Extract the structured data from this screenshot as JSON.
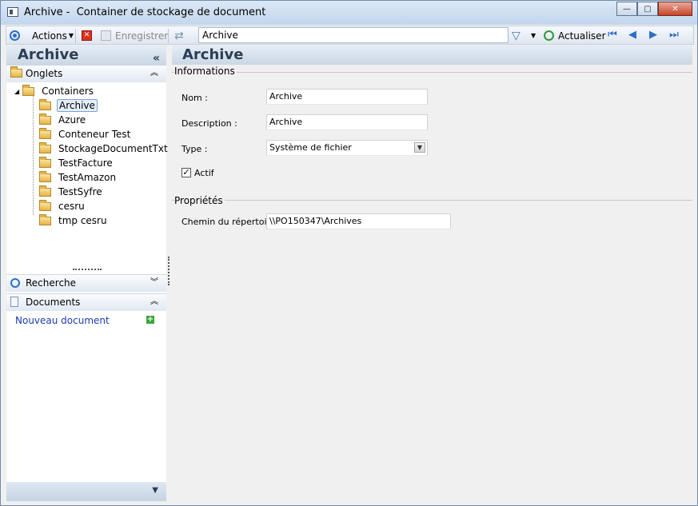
{
  "window": {
    "title": "Archive -  Container de stockage de document"
  },
  "toolbar": {
    "actions_label": "Actions",
    "save_label": "Enregistrer",
    "search_value": "Archive",
    "refresh_label": "Actualiser"
  },
  "left": {
    "header": "Archive",
    "onglets": "Onglets",
    "tree_root": "Containers",
    "tree_items": [
      "Archive",
      "Azure",
      "Conteneur Test",
      "StockageDocumentTxt",
      "TestFacture",
      "TestAmazon",
      "TestSyfre",
      "cesru",
      "tmp cesru"
    ],
    "recherche": "Recherche",
    "documents": "Documents",
    "new_document": "Nouveau document"
  },
  "right": {
    "header": "Archive",
    "informations": "Informations",
    "nom_label": "Nom :",
    "nom_value": "Archive",
    "description_label": "Description :",
    "description_value": "Archive",
    "type_label": "Type :",
    "type_value": "Système de fichier",
    "actif_label": "Actif",
    "proprietes": "Propriétés",
    "chemin_label": "Chemin du répertoire :",
    "chemin_value": "\\\\PO150347\\Archives"
  },
  "colors": {
    "accent": "#2a6fcc",
    "header_text": "#2b3e55",
    "link": "#1b3cb0"
  }
}
